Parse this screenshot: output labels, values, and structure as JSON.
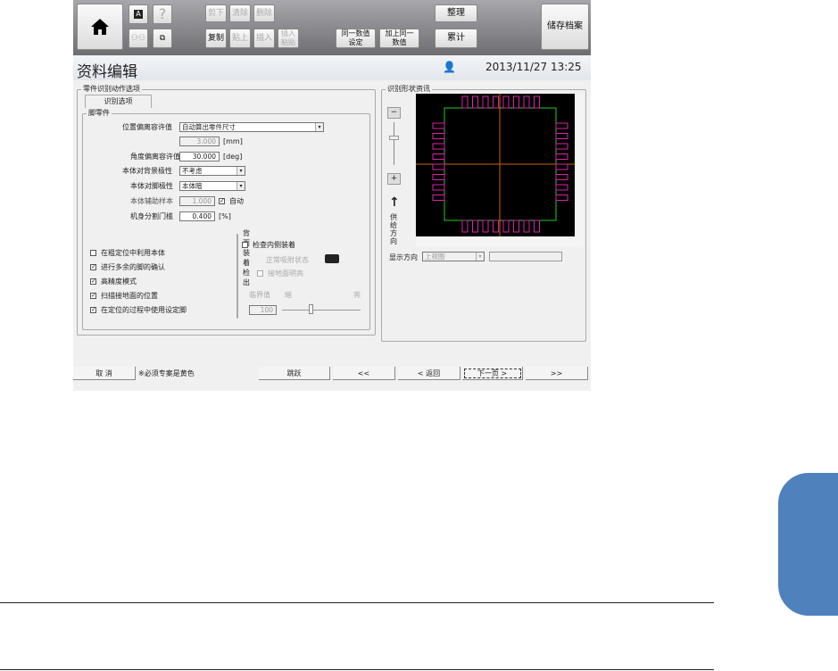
{
  "toolbar": {
    "cut": "剪下",
    "clear": "清除",
    "delete": "删除",
    "copy": "复制",
    "paste": "贴上",
    "insert": "插入",
    "insert_paste": "插入\n粘贴",
    "same_value": "同一数值\n设定",
    "add_same": "加上同一\n数值",
    "arrange": "整理",
    "accumulate": "累计",
    "save": "储存档案",
    "help": "?"
  },
  "header": {
    "title": "资料编辑",
    "datetime": "2013/11/27 13:25"
  },
  "left_group": {
    "legend": "零件识别动作选项",
    "tab": "识别选项",
    "sub_legend": "脚零件",
    "pos_tol_label": "位置偏离容许值",
    "pos_tol_value": "自动算出零件尺寸",
    "pos_tol_mm": "3.000",
    "mm_unit": "[mm]",
    "ang_tol_label": "角度偏离容许值",
    "ang_tol_value": "30.000",
    "deg_unit": "[deg]",
    "bg_pol_label": "本体对背景极性",
    "bg_pol_value": "不考虑",
    "pin_pol_label": "本体对脚极性",
    "pin_pol_value": "本体暗",
    "aux_label": "本体辅助样本",
    "aux_value": "1.000",
    "auto_label": "自动",
    "thr_label": "机身分割门槛",
    "thr_value": "0.400",
    "thr_unit": "[%]",
    "checks": [
      {
        "label": "在粗定位中利用本体",
        "checked": false
      },
      {
        "label": "进行多余的脚的确认",
        "checked": true
      },
      {
        "label": "高精度模式",
        "checked": true
      },
      {
        "label": "扫描接地面的位置",
        "checked": true
      },
      {
        "label": "在定位的过程中使用设定脚",
        "checked": true
      }
    ],
    "back": {
      "legend": "背面装着检出",
      "inner_label": "检查内侧装着",
      "normal_label": "正常吸附状态",
      "ground_label": "接地面明亮",
      "limit_label": "临界值",
      "dark": "暗",
      "bright": "亮",
      "limit_value": "100"
    }
  },
  "right_group": {
    "legend": "识别形状资讯",
    "feed_dir": "供\n给\n方\n向",
    "view_label": "显示方向",
    "view_value": "上视图"
  },
  "footer": {
    "cancel": "取 消",
    "note": "※必须专案是黄色",
    "jump": "跳跃",
    "first": "<<",
    "back": "< 返回",
    "next": "下一页 >",
    "last": ">>"
  }
}
